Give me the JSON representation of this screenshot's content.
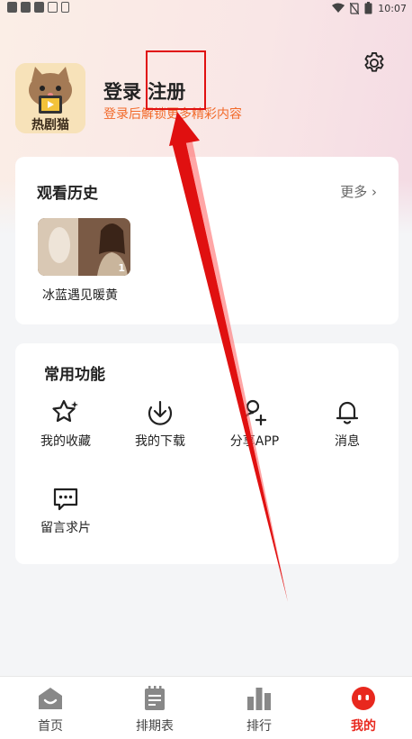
{
  "status_bar": {
    "time": "10:07"
  },
  "profile": {
    "avatar_text": "热剧猫",
    "login_label": "登录 注册",
    "subtitle": "登录后解锁更多精彩内容"
  },
  "history": {
    "title": "观看历史",
    "more_label": "更多",
    "items": [
      {
        "caption": "冰蓝遇见暖黄",
        "episode": "1"
      }
    ]
  },
  "functions": {
    "title": "常用功能",
    "items": [
      {
        "label": "我的收藏",
        "icon": "star-icon"
      },
      {
        "label": "我的下载",
        "icon": "download-icon"
      },
      {
        "label": "分享APP",
        "icon": "add-user-icon"
      },
      {
        "label": "消息",
        "icon": "bell-icon"
      },
      {
        "label": "留言求片",
        "icon": "chat-icon"
      }
    ]
  },
  "bottom_nav": {
    "items": [
      {
        "label": "首页",
        "icon": "home-icon"
      },
      {
        "label": "排期表",
        "icon": "schedule-icon"
      },
      {
        "label": "排行",
        "icon": "ranking-icon"
      },
      {
        "label": "我的",
        "icon": "mine-icon"
      }
    ],
    "active_index": 3,
    "active_color": "#e8281e"
  },
  "annotation_color": "#e01010"
}
